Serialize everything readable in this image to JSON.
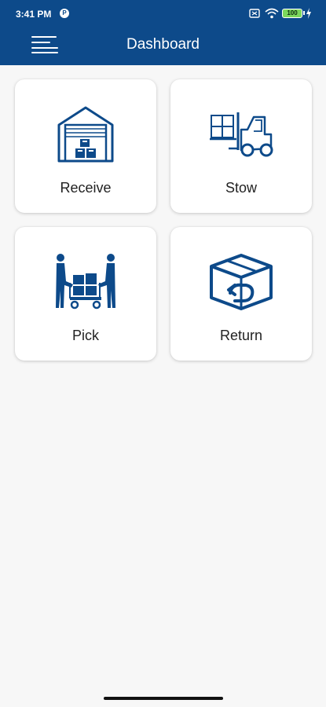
{
  "status_bar": {
    "time": "3:41 PM",
    "app_badge": "P",
    "battery_level": "100"
  },
  "header": {
    "title": "Dashboard",
    "menu_icon": "hamburger-menu-icon",
    "background_color": "#0d4a8a"
  },
  "tiles": [
    {
      "label": "Receive",
      "icon": "warehouse-icon"
    },
    {
      "label": "Stow",
      "icon": "forklift-icon"
    },
    {
      "label": "Pick",
      "icon": "cart-handoff-icon"
    },
    {
      "label": "Return",
      "icon": "box-return-icon"
    }
  ],
  "colors": {
    "icon": "#0d4a8a",
    "page_background": "#f7f7f7",
    "card_background": "#ffffff"
  }
}
